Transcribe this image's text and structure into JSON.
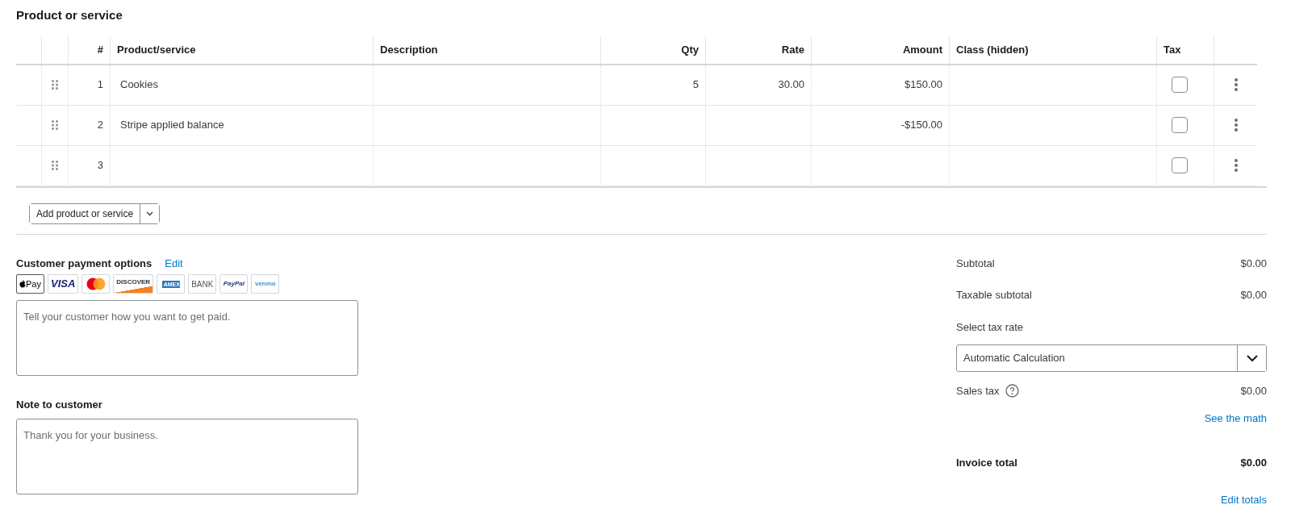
{
  "section_title": "Product or service",
  "table": {
    "columns": [
      "#",
      "Product/service",
      "Description",
      "Qty",
      "Rate",
      "Amount",
      "Class (hidden)",
      "Tax"
    ],
    "rows": [
      {
        "number": "1",
        "product": "Cookies",
        "description": "",
        "qty": "5",
        "rate": "30.00",
        "amount": "$150.00",
        "class": "",
        "taxable": false
      },
      {
        "number": "2",
        "product": "Stripe applied balance",
        "description": "",
        "qty": "",
        "rate": "",
        "amount": "-$150.00",
        "class": "",
        "taxable": false
      },
      {
        "number": "3",
        "product": "",
        "description": "",
        "qty": "",
        "rate": "",
        "amount": "",
        "class": "",
        "taxable": false
      }
    ]
  },
  "add_button": "Add product or service",
  "payment": {
    "title": "Customer payment options",
    "edit_link": "Edit",
    "methods": [
      {
        "kind": "applepay",
        "label": "Pay"
      },
      {
        "kind": "visa",
        "label": "VISA"
      },
      {
        "kind": "mastercard"
      },
      {
        "kind": "discover",
        "label": "DISCOVER"
      },
      {
        "kind": "amex",
        "label": "AMEX"
      },
      {
        "kind": "bank",
        "label": "BANK"
      },
      {
        "kind": "paypal",
        "label": "PayPal"
      },
      {
        "kind": "venmo",
        "label": "venmo"
      }
    ],
    "placeholder": "Tell your customer how you want to get paid."
  },
  "note": {
    "label": "Note to customer",
    "placeholder": "Thank you for your business."
  },
  "totals": {
    "subtotal": {
      "label": "Subtotal",
      "value": "$0.00"
    },
    "taxable_subtotal": {
      "label": "Taxable subtotal",
      "value": "$0.00"
    },
    "tax_rate_label": "Select tax rate",
    "tax_rate_value": "Automatic Calculation",
    "sales_tax": {
      "label": "Sales tax",
      "value": "$0.00"
    },
    "see_math": "See the math",
    "invoice_total": {
      "label": "Invoice total",
      "value": "$0.00"
    },
    "edit_totals": "Edit totals"
  }
}
